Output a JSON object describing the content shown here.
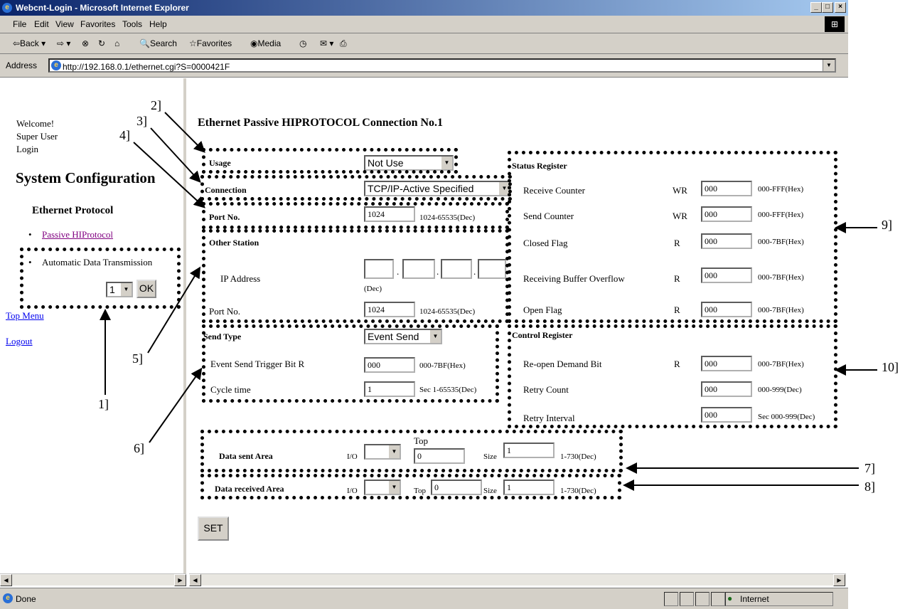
{
  "window": {
    "title": "Webcnt-Login - Microsoft Internet Explorer",
    "controls": [
      "_",
      "□",
      "×"
    ]
  },
  "menu": [
    "File",
    "Edit",
    "View",
    "Favorites",
    "Tools",
    "Help"
  ],
  "toolbar": {
    "back": "⇦Back ▾",
    "forward": "⇨ ▾",
    "stop": "⊗",
    "refresh": "↻",
    "home": "⌂",
    "search": "Search",
    "favorites": "Favorites",
    "media": "Media",
    "history": "◷",
    "mail": "✉ ▾",
    "print": "⎙"
  },
  "address": {
    "label": "Address",
    "url": "http://192.168.0.1/ethernet.cgi?S=0000421F"
  },
  "sidebar": {
    "welcome": "Welcome!",
    "user": "Super User",
    "login": "Login",
    "heading": "System Configuration",
    "subheading": "Ethernet Protocol",
    "link_passive": "Passive HIProtocol",
    "auto_label": "Automatic Data Transmission",
    "auto_select": "1",
    "ok": "OK",
    "top_menu": "Top Menu",
    "logout": "Logout"
  },
  "page": {
    "title": "Ethernet Passive HIPROTOCOL Connection No.1",
    "usage": {
      "label": "Usage",
      "value": "Not Use"
    },
    "connection": {
      "label": "Connection",
      "value": "TCP/IP-Active Specified"
    },
    "port": {
      "label": "Port No.",
      "value": "1024",
      "range": "1024-65535(Dec)"
    },
    "other_station": {
      "heading": "Other Station",
      "ip_label": "IP Address",
      "ip_unit": "(Dec)",
      "port_label": "Port No.",
      "port_value": "1024",
      "port_range": "1024-65535(Dec)"
    },
    "send_type": {
      "label": "Send Type",
      "value": "Event Send",
      "trigger_label": "Event Send Trigger Bit R",
      "trigger_value": "000",
      "trigger_range": "000-7BF(Hex)",
      "cycle_label": "Cycle time",
      "cycle_value": "1",
      "cycle_range": "Sec 1-65535(Dec)"
    },
    "status_register": {
      "heading": "Status Register",
      "rows": [
        {
          "label": "Receive Counter",
          "access": "WR",
          "value": "000",
          "range": "000-FFF(Hex)"
        },
        {
          "label": "Send Counter",
          "access": "WR",
          "value": "000",
          "range": "000-FFF(Hex)"
        },
        {
          "label": "Closed Flag",
          "access": "R",
          "value": "000",
          "range": "000-7BF(Hex)"
        },
        {
          "label": "Receiving Buffer Overflow",
          "access": "R",
          "value": "000",
          "range": "000-7BF(Hex)"
        },
        {
          "label": "Open Flag",
          "access": "R",
          "value": "000",
          "range": "000-7BF(Hex)"
        }
      ]
    },
    "control_register": {
      "heading": "Control Register",
      "rows": [
        {
          "label": "Re-open Demand Bit",
          "access": "R",
          "value": "000",
          "range": "000-7BF(Hex)"
        },
        {
          "label": "Retry Count",
          "access": "",
          "value": "000",
          "range": "000-999(Dec)"
        },
        {
          "label": "Retry Interval",
          "access": "",
          "value": "000",
          "range": "Sec 000-999(Dec)"
        }
      ]
    },
    "data_sent": {
      "label": "Data sent Area",
      "io": "I/O",
      "top_label": "Top",
      "top_value": "0",
      "size_label": "Size",
      "size_value": "1",
      "range": "1-730(Dec)"
    },
    "data_received": {
      "label": "Data received Area",
      "io": "I/O",
      "top_label": "Top",
      "top_value": "0",
      "size_label": "Size",
      "size_value": "1",
      "range": "1-730(Dec)"
    },
    "set": "SET"
  },
  "callouts": {
    "c1": "1]",
    "c2": "2]",
    "c3": "3]",
    "c4": "4]",
    "c5": "5]",
    "c6": "6]",
    "c7": "7]",
    "c8": "8]",
    "c9": "9]",
    "c10": "10]"
  },
  "status": {
    "text": "Done",
    "zone": "Internet"
  }
}
